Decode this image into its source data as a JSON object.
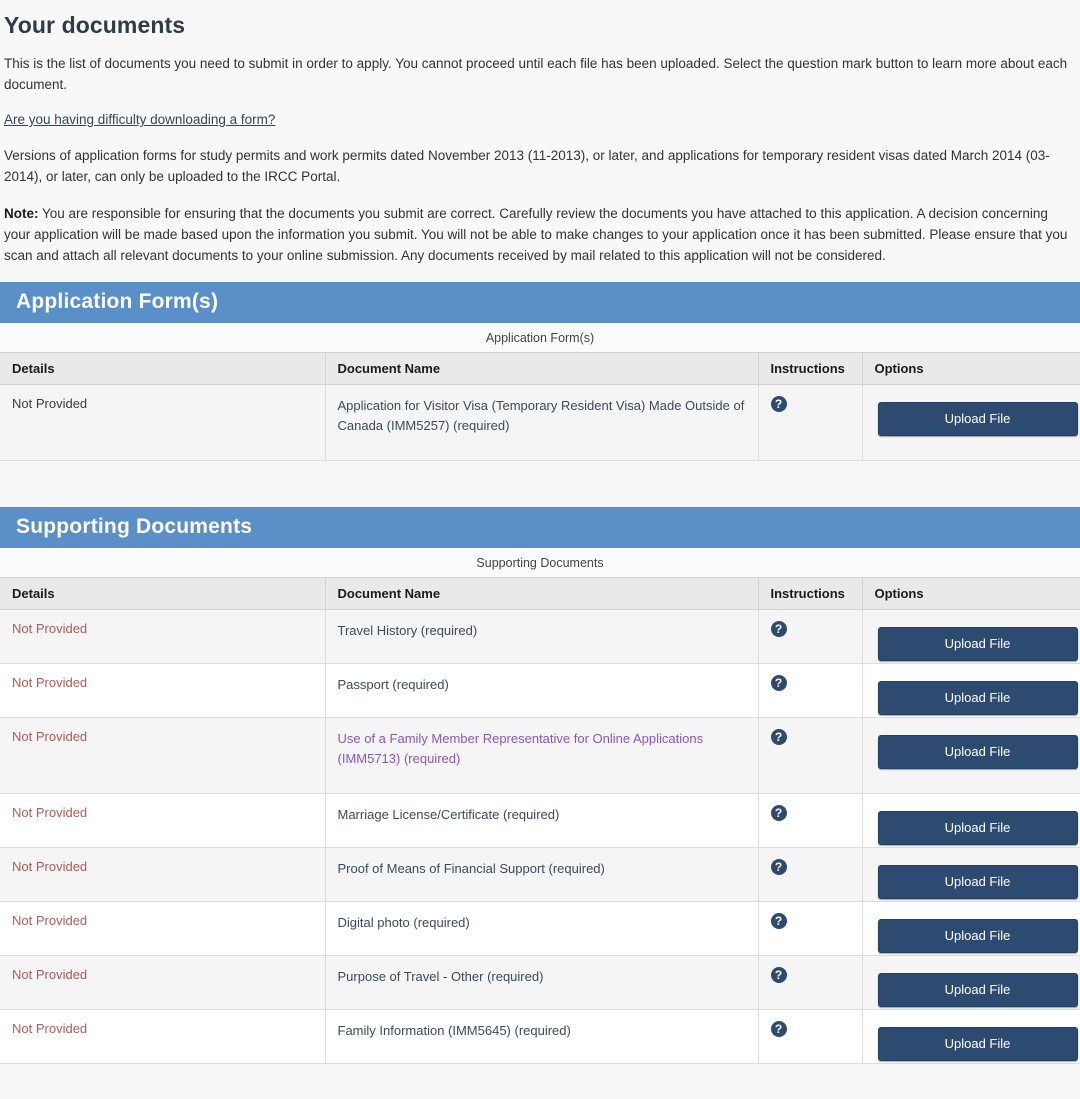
{
  "page": {
    "title": "Your documents",
    "intro": "This is the list of documents you need to submit in order to apply. You cannot proceed until each file has been uploaded. Select the question mark button to learn more about each document.",
    "help_link": "Are you having difficulty downloading a form?",
    "versions_note": "Versions of application forms for study permits and work permits dated November 2013 (11-2013), or later, and applications for temporary resident visas dated March 2014 (03-2014), or later, can only be uploaded to the IRCC Portal.",
    "note_label": "Note:",
    "note_text": " You are responsible for ensuring that the documents you submit are correct. Carefully review the documents you have attached to this application. A decision concerning your application will be made based upon the information you submit. You will not be able to make changes to your application once it has been submitted. Please ensure that you scan and attach all relevant documents to your online submission.  Any documents received by mail related to this application will not be considered."
  },
  "colors": {
    "banner_blue": "#5b8fc7",
    "button_navy": "#2d4b70",
    "link_slate": "#3c4a5e",
    "link_visited": "#8a57b8",
    "status_missing_red": "#b05a5a",
    "page_background": "#f8f8f8"
  },
  "icons": {
    "help": "?"
  },
  "buttons": {
    "upload_label": "Upload File"
  },
  "columns": {
    "details": "Details",
    "document_name": "Document Name",
    "instructions": "Instructions",
    "options": "Options"
  },
  "application_forms": {
    "banner": "Application Form(s)",
    "caption": "Application Form(s)",
    "rows": [
      {
        "details": "Not Provided",
        "details_state": "neutral",
        "document_name": "Application for Visitor Visa (Temporary Resident Visa) Made Outside of Canada (IMM5257)  (required)",
        "link_state": "link",
        "instructions_icon": "?",
        "option_label": "Upload File"
      }
    ]
  },
  "supporting_documents": {
    "banner": "Supporting Documents",
    "caption": "Supporting Documents",
    "rows": [
      {
        "details": "Not Provided",
        "details_state": "missing",
        "document_name": "Travel History  (required)",
        "link_state": "plain",
        "instructions_icon": "?",
        "option_label": "Upload File"
      },
      {
        "details": "Not Provided",
        "details_state": "missing",
        "document_name": "Passport  (required)",
        "link_state": "plain",
        "instructions_icon": "?",
        "option_label": "Upload File"
      },
      {
        "details": "Not Provided",
        "details_state": "missing",
        "document_name": "Use of a Family Member Representative for Online Applications (IMM5713)  (required)",
        "link_state": "visited",
        "instructions_icon": "?",
        "option_label": "Upload File"
      },
      {
        "details": "Not Provided",
        "details_state": "missing",
        "document_name": "Marriage License/Certificate  (required)",
        "link_state": "plain",
        "instructions_icon": "?",
        "option_label": "Upload File"
      },
      {
        "details": "Not Provided",
        "details_state": "missing",
        "document_name": "Proof of Means of Financial Support  (required)",
        "link_state": "plain",
        "instructions_icon": "?",
        "option_label": "Upload File"
      },
      {
        "details": "Not Provided",
        "details_state": "missing",
        "document_name": "Digital photo  (required)",
        "link_state": "plain",
        "instructions_icon": "?",
        "option_label": "Upload File"
      },
      {
        "details": "Not Provided",
        "details_state": "missing",
        "document_name": "Purpose of Travel - Other  (required)",
        "link_state": "plain",
        "instructions_icon": "?",
        "option_label": "Upload File"
      },
      {
        "details": "Not Provided",
        "details_state": "missing",
        "document_name": "Family Information (IMM5645)  (required)",
        "link_state": "plain",
        "instructions_icon": "?",
        "option_label": "Upload File"
      }
    ]
  }
}
